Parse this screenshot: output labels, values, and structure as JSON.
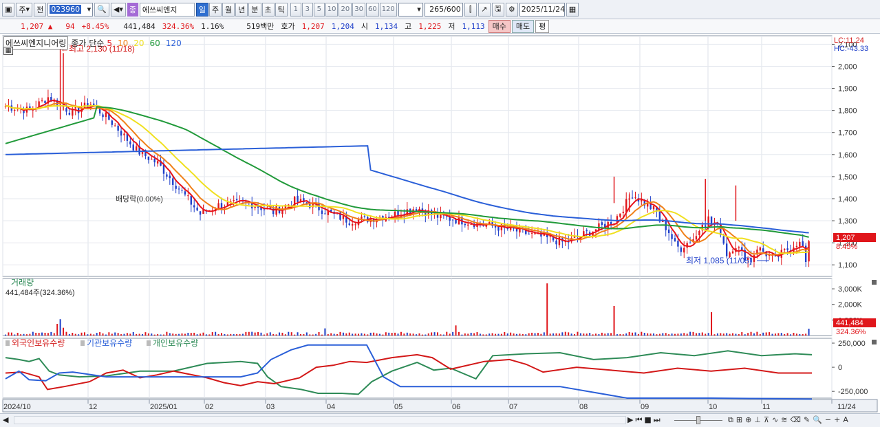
{
  "toolbar": {
    "market": "주",
    "prefix": "전",
    "code": "023960",
    "type_badge": "종",
    "stock_name": "에쓰씨엔지",
    "periods": [
      "일",
      "주",
      "월",
      "년",
      "분",
      "초",
      "틱"
    ],
    "active_period": "일",
    "intervals": [
      "1",
      "3",
      "5",
      "10",
      "20",
      "30",
      "60",
      "120"
    ],
    "count": "265",
    "max_count": "/600",
    "date": "2025/11/24"
  },
  "quote": {
    "price": "1,207",
    "arrow": "▲",
    "change": "94",
    "change_pct": "+8.45%",
    "volume": "441,484",
    "volume_ratio": "324.36%",
    "turnover": "1.16%",
    "amount": "519백만",
    "hoga_label": "호가",
    "ask": "1,207",
    "bid": "1,204",
    "open_label": "시",
    "open": "1,134",
    "high_label": "고",
    "high": "1,225",
    "low_label": "저",
    "low": "1,113",
    "buy_label": "매수",
    "sell_label": "매도",
    "avg_label": "평"
  },
  "price_panel": {
    "stock_tag": "에쓰씨엔지니어링",
    "ma_label": "종가 단순",
    "ma_periods": [
      "5",
      "10",
      "20",
      "60",
      "120"
    ],
    "ma_colors": [
      "#e8141b",
      "#f08018",
      "#f0e020",
      "#219a3a",
      "#2a5fd8"
    ],
    "max_annot": "←최고 2,130 (11/18)",
    "min_annot": "최저 1,085 (11/05)",
    "ex_div": "배당락(0.00%)",
    "lc": "LC:11.24",
    "hc": "HC:-43.33",
    "y_ticks": [
      "2,100",
      "2,000",
      "1,900",
      "1,800",
      "1,700",
      "1,600",
      "1,500",
      "1,400",
      "1,300",
      "1,200",
      "1,100"
    ],
    "last_price_tag": "1,207",
    "last_change_tag": "8.45%"
  },
  "volume_panel": {
    "title": "거래량",
    "value": "441,484주(324.36%)",
    "y_ticks": [
      "3,000K",
      "2,000K",
      "1,000K"
    ],
    "last_tag": "441,484",
    "last_pct": "324.36%"
  },
  "holdings_panel": {
    "series": [
      {
        "name": "외국인보유수량",
        "color": "#d31818"
      },
      {
        "name": "기관보유수량",
        "color": "#2a5fd8"
      },
      {
        "name": "개인보유수량",
        "color": "#2e8b57"
      }
    ],
    "y_ticks": [
      "250,000",
      "0",
      "-250,000"
    ]
  },
  "x_axis": [
    "2024/10",
    "12",
    "2025/01",
    "02",
    "03",
    "04",
    "05",
    "06",
    "07",
    "08",
    "09",
    "10",
    "11",
    "11/24"
  ]
}
